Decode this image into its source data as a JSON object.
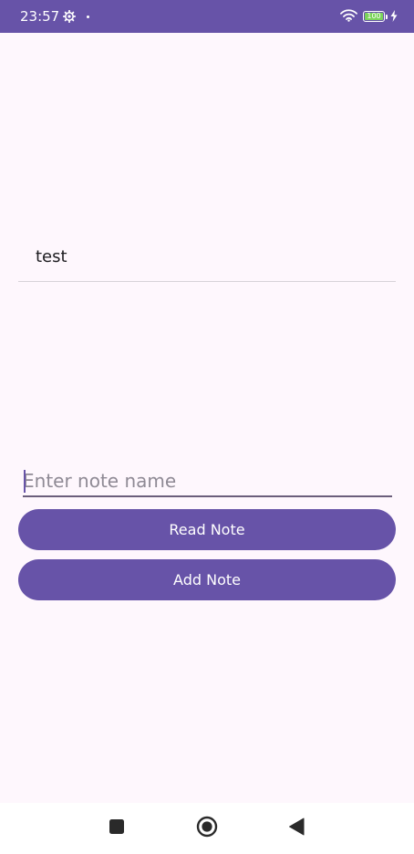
{
  "status_bar": {
    "time": "23:57",
    "battery_level": "100",
    "background_color": "#6753a8",
    "icons": [
      "gear-icon",
      "notification-dot-icon",
      "wifi-icon",
      "battery-icon",
      "charging-bolt-icon"
    ]
  },
  "notes_list": {
    "items": [
      {
        "label": "test"
      }
    ]
  },
  "note_form": {
    "name_placeholder": "Enter note name",
    "name_value": "",
    "read_button_label": "Read Note",
    "add_button_label": "Add Note"
  },
  "theme": {
    "primary": "#6753a8",
    "background": "#fef7fd",
    "divider": "#d7d2d9"
  },
  "nav_bar": {
    "icons": [
      "recents-square-icon",
      "home-circle-icon",
      "back-triangle-icon"
    ]
  }
}
